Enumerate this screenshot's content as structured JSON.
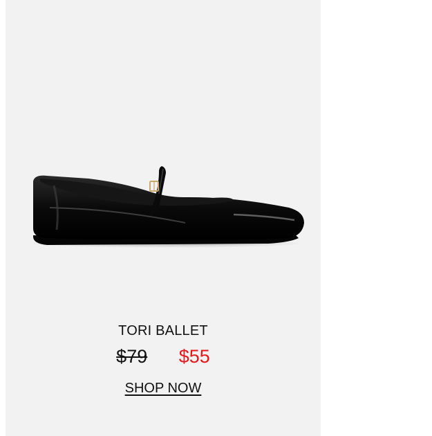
{
  "product": {
    "name": "TORI BALLET",
    "price_original": "$79",
    "price_sale": "$55",
    "cta_label": "SHOP NOW",
    "image_icon": "black-patent-mary-jane-ballet-flat"
  },
  "colors": {
    "card_background": "#f2f2f2",
    "page_background": "#ffffff",
    "sale_price": "#e4181c",
    "text": "#111111"
  }
}
